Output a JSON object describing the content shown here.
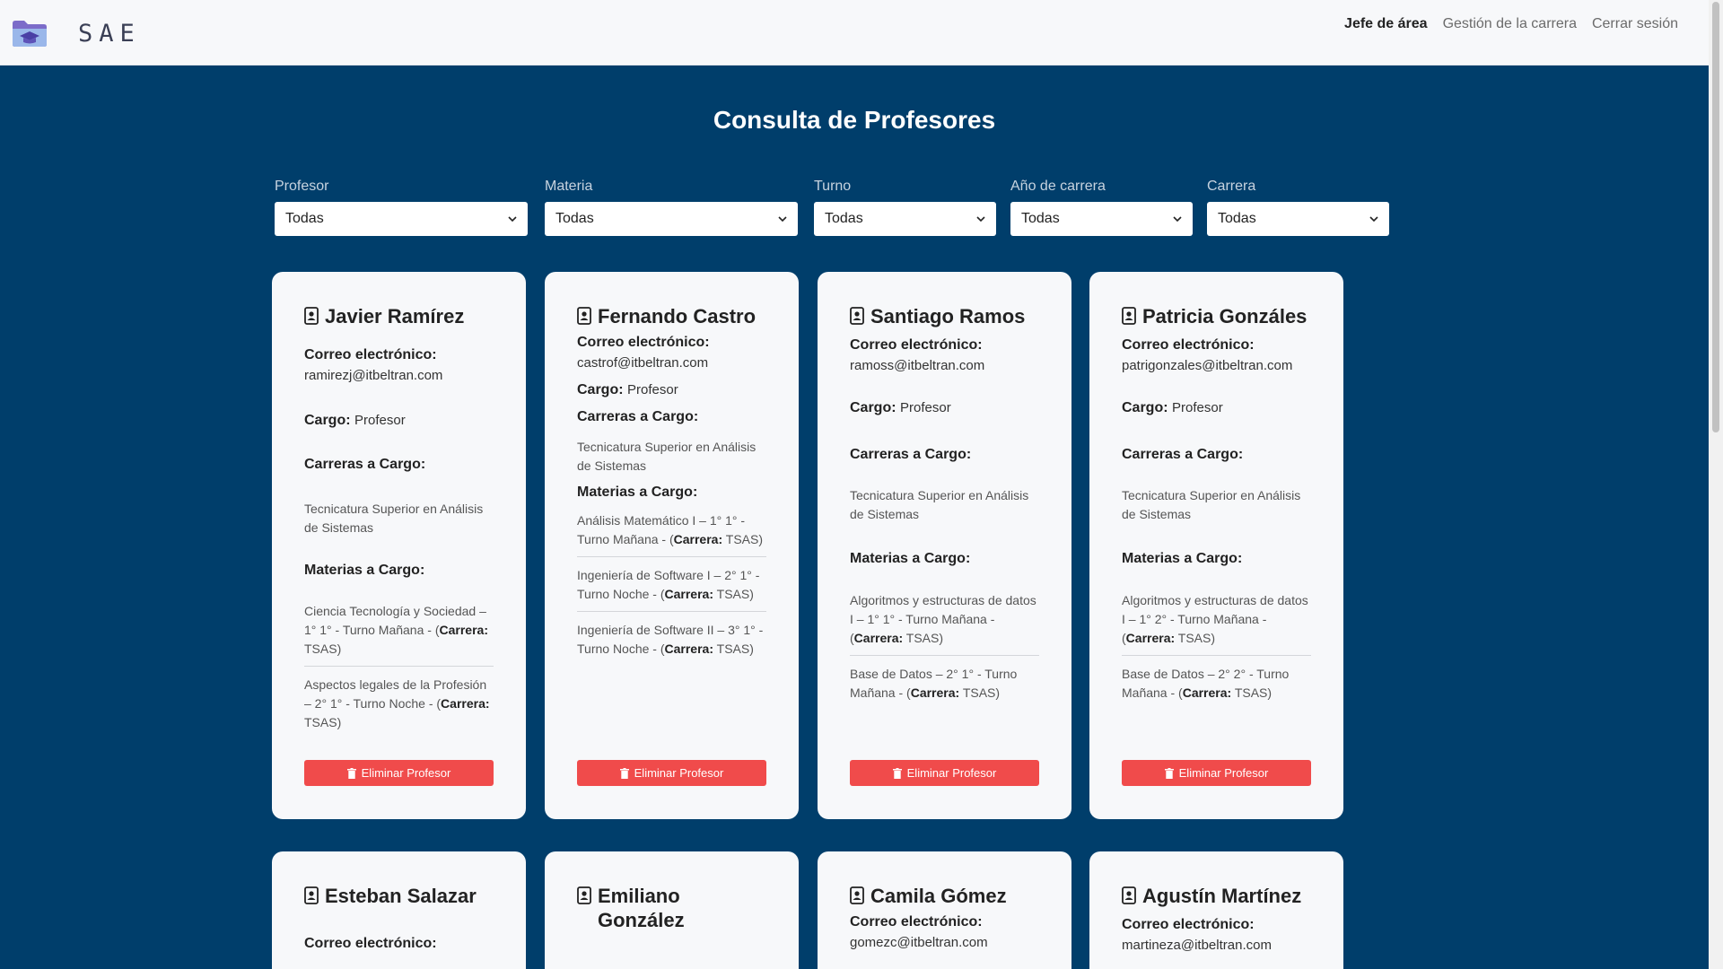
{
  "nav": {
    "brand": "SAE",
    "links": [
      "Jefe de área",
      "Gestión de la carrera",
      "Cerrar sesión"
    ]
  },
  "page": {
    "title": "Consulta de Profesores"
  },
  "filters": [
    {
      "label": "Profesor",
      "value": "Todas"
    },
    {
      "label": "Materia",
      "value": "Todas"
    },
    {
      "label": "Turno",
      "value": "Todas"
    },
    {
      "label": "Año de carrera",
      "value": "Todas"
    },
    {
      "label": "Carrera",
      "value": "Todas"
    }
  ],
  "labels": {
    "email": "Correo electrónico:",
    "cargo": "Cargo:",
    "carreras": "Carreras a Cargo:",
    "materias": "Materias a Cargo:",
    "carrera_inline": "Carrera:",
    "delete": "Eliminar Profesor"
  },
  "professors": [
    {
      "name": "Javier Ramírez",
      "email": "ramirezj@itbeltran.com",
      "cargo": "Profesor",
      "carrera": "Tecnicatura Superior en Análisis de Sistemas",
      "materias": [
        {
          "pre": "Ciencia Tecnología y Sociedad – 1° 1° - Turno Mañana - (",
          "post": " TSAS)"
        },
        {
          "pre": "Aspectos legales de la Profesión – 2° 1° - Turno Noche - (",
          "post": " TSAS)"
        }
      ]
    },
    {
      "name": "Fernando Castro",
      "email": "castrof@itbeltran.com",
      "cargo": "Profesor",
      "carrera": "Tecnicatura Superior en Análisis de Sistemas",
      "materias": [
        {
          "pre": "Análisis Matemático I – 1° 1° - Turno Mañana - (",
          "post": " TSAS)"
        },
        {
          "pre": "Ingeniería de Software I – 2° 1° - Turno Noche - (",
          "post": " TSAS)"
        },
        {
          "pre": "Ingeniería de Software II – 3° 1° - Turno Noche - (",
          "post": " TSAS)"
        }
      ]
    },
    {
      "name": "Santiago Ramos",
      "email": "ramoss@itbeltran.com",
      "cargo": "Profesor",
      "carrera": "Tecnicatura Superior en Análisis de Sistemas",
      "materias": [
        {
          "pre": "Algoritmos y estructuras de datos I – 1° 1° - Turno Mañana - (",
          "post": " TSAS)"
        },
        {
          "pre": "Base de Datos – 2° 1° - Turno Mañana - (",
          "post": " TSAS)"
        }
      ]
    },
    {
      "name": "Patricia Gonzáles",
      "email": "patrigonzales@itbeltran.com",
      "cargo": "Profesor",
      "carrera": "Tecnicatura Superior en Análisis de Sistemas",
      "materias": [
        {
          "pre": "Algoritmos y estructuras de datos I – 1° 2° - Turno Mañana - (",
          "post": " TSAS)"
        },
        {
          "pre": "Base de Datos – 2° 2° - Turno Mañana - (",
          "post": " TSAS)"
        }
      ]
    },
    {
      "name": "Esteban Salazar"
    },
    {
      "name": "Emiliano González"
    },
    {
      "name": "Camila Gómez",
      "email": "gomezc@itbeltran.com"
    },
    {
      "name": "Agustín Martínez",
      "email": "martineza@itbeltran.com"
    }
  ]
}
